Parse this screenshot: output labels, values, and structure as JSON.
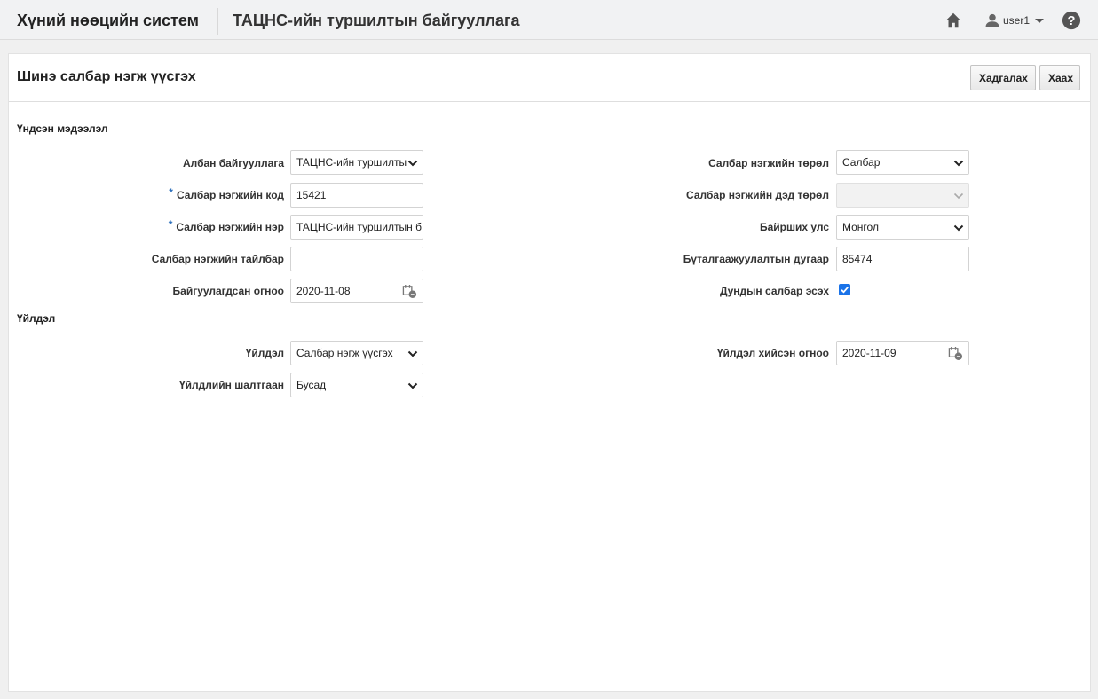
{
  "header": {
    "app_title": "Хүний нөөцийн систем",
    "org_title": "ТАЦНС-ийн туршилтын байгууллага",
    "user_name": "user1"
  },
  "page": {
    "title": "Шинэ салбар нэгж үүсгэх",
    "save_label": "Хадгалах",
    "close_label": "Хаах"
  },
  "basic_info": {
    "section_title": "Үндсэн мэдээлэл",
    "org_label": "Албан байгууллага",
    "org_value": "ТАЦНС-ийн туршилты",
    "code_label": "Салбар нэгжийн код",
    "code_value": "15421",
    "name_label": "Салбар нэгжийн нэр",
    "name_value": "ТАЦНС-ийн туршилтын б",
    "desc_label": "Салбар нэгжийн тайлбар",
    "desc_value": "",
    "founded_label": "Байгуулагдсан огноо",
    "founded_value": "2020-11-08",
    "type_label": "Салбар нэгжийн төрөл",
    "type_value": "Салбар",
    "subtype_label": "Салбар нэгжийн дэд төрөл",
    "subtype_value": "",
    "country_label": "Байрших улс",
    "country_value": "Монгол",
    "reg_label": "Бүталгаажуулалтын дугаар",
    "reg_value": "85474",
    "common_label": "Дундын салбар эсэх",
    "common_checked": true
  },
  "action": {
    "section_title": "Үйлдэл",
    "action_label": "Үйлдэл",
    "action_value": "Салбар нэгж үүсгэх",
    "reason_label": "Үйлдлийн шалтгаан",
    "reason_value": "Бусад",
    "date_label": "Үйлдэл хийсэн огноо",
    "date_value": "2020-11-09"
  },
  "icons": {
    "home": "home-icon",
    "user": "user-icon",
    "help": "help-icon",
    "calendar": "calendar-icon",
    "dropdown": "chevron-down-icon"
  },
  "colors": {
    "accent": "#1a73e8",
    "required": "#2a6ebb",
    "header_bg": "#f1f2f3"
  }
}
